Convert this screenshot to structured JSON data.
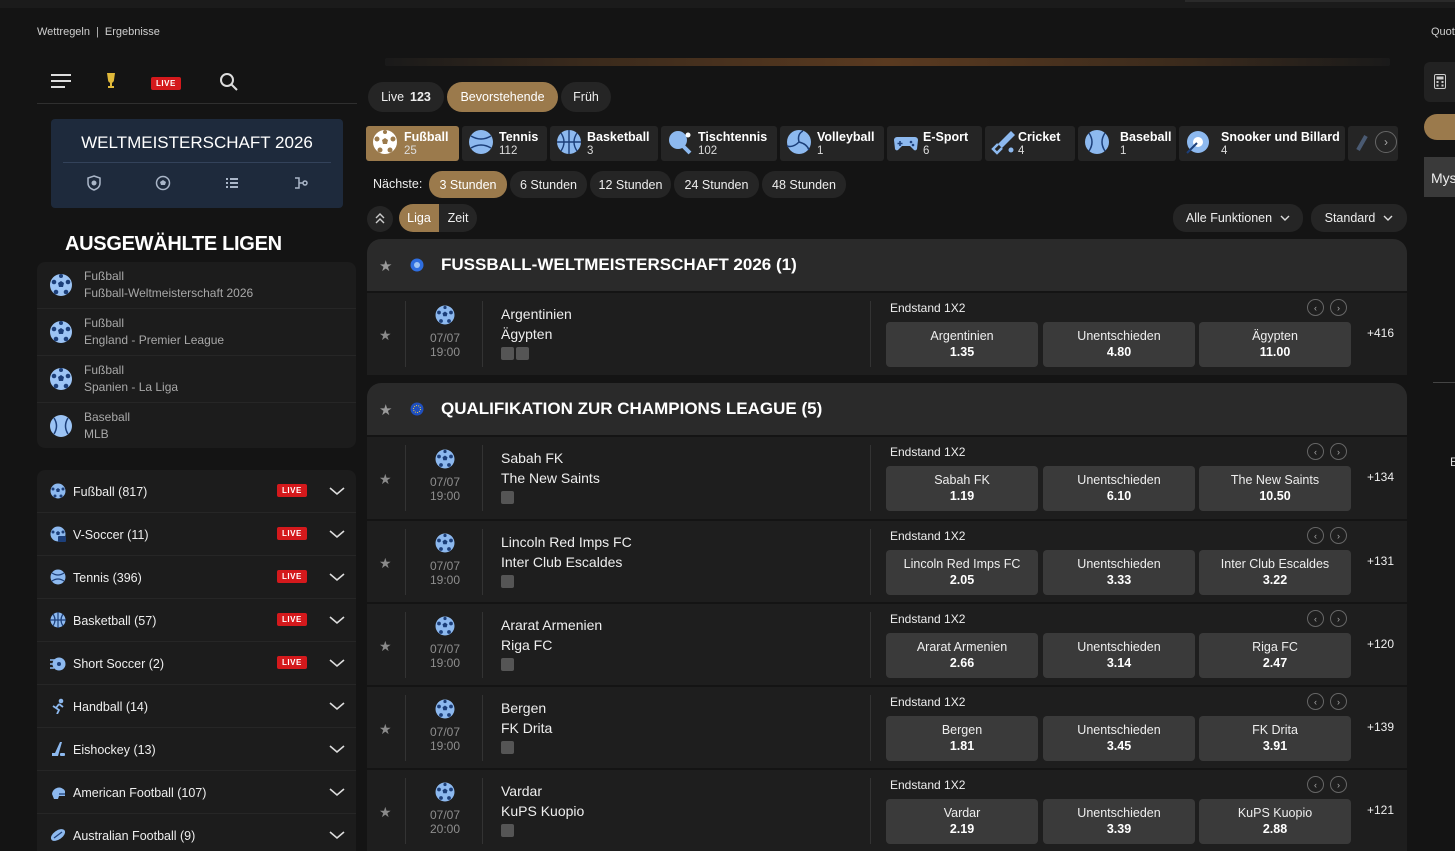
{
  "top": {
    "links": [
      "Wettregeln",
      "Ergebnisse"
    ],
    "separator": "|",
    "right_label": "Quot"
  },
  "nav_icons": [
    "menu-icon",
    "trophy-icon",
    "live-badge",
    "search-icon"
  ],
  "live_label": "LIVE",
  "featured": {
    "title": "WELTMEISTERSCHAFT 2026",
    "icons": [
      "shield-icon",
      "football-icon",
      "list-icon",
      "bracket-icon"
    ]
  },
  "ausgewaehlte": {
    "title": "AUSGEWÄHLTE LIGEN",
    "items": [
      {
        "sport": "Fußball",
        "league": "Fußball-Weltmeisterschaft 2026"
      },
      {
        "sport": "Fußball",
        "league": "England - Premier League"
      },
      {
        "sport": "Fußball",
        "league": "Spanien - La Liga"
      },
      {
        "sport": "Baseball",
        "league": "MLB"
      }
    ]
  },
  "sports": [
    {
      "label": "Fußball (817)",
      "live": true
    },
    {
      "label": "V-Soccer (11)",
      "live": true
    },
    {
      "label": "Tennis (396)",
      "live": true
    },
    {
      "label": "Basketball (57)",
      "live": true
    },
    {
      "label": "Short Soccer (2)",
      "live": true
    },
    {
      "label": "Handball (14)",
      "live": false
    },
    {
      "label": "Eishockey (13)",
      "live": false
    },
    {
      "label": "American Football (107)",
      "live": false
    },
    {
      "label": "Australian Football (9)",
      "live": false
    }
  ],
  "tabs": {
    "live": "Live",
    "live_count": "123",
    "upcoming": "Bevorstehende",
    "early": "Früh"
  },
  "categories": [
    {
      "name": "Fußball",
      "count": "25"
    },
    {
      "name": "Tennis",
      "count": "112"
    },
    {
      "name": "Basketball",
      "count": "3"
    },
    {
      "name": "Tischtennis",
      "count": "102"
    },
    {
      "name": "Volleyball",
      "count": "1"
    },
    {
      "name": "E-Sport",
      "count": "6"
    },
    {
      "name": "Cricket",
      "count": "4"
    },
    {
      "name": "Baseball",
      "count": "1"
    },
    {
      "name": "Snooker und Billard",
      "count": "4"
    }
  ],
  "naechste": {
    "label": "Nächste:",
    "options": [
      "3 Stunden",
      "6 Stunden",
      "12 Stunden",
      "24 Stunden",
      "48 Stunden"
    ]
  },
  "sort": {
    "liga": "Liga",
    "zeit": "Zeit"
  },
  "filters": {
    "functions": "Alle Funktionen",
    "standard": "Standard"
  },
  "sections": [
    {
      "title": "FUSSBALL-WELTMEISTERSCHAFT 2026 (1)"
    },
    {
      "title": "QUALIFIKATION ZUR CHAMPIONS LEAGUE (5)"
    }
  ],
  "market_label": "Endstand 1X2",
  "matches": [
    {
      "date": "07/07",
      "time": "19:00",
      "home": "Argentinien",
      "away": "Ägypten",
      "odds": [
        {
          "label": "Argentinien",
          "value": "1.35"
        },
        {
          "label": "Unentschieden",
          "value": "4.80"
        },
        {
          "label": "Ägypten",
          "value": "11.00"
        }
      ],
      "more": "+416"
    },
    {
      "date": "07/07",
      "time": "19:00",
      "home": "Sabah FK",
      "away": "The New Saints",
      "odds": [
        {
          "label": "Sabah FK",
          "value": "1.19"
        },
        {
          "label": "Unentschieden",
          "value": "6.10"
        },
        {
          "label": "The New Saints",
          "value": "10.50"
        }
      ],
      "more": "+134"
    },
    {
      "date": "07/07",
      "time": "19:00",
      "home": "Lincoln Red Imps FC",
      "away": "Inter Club Escaldes",
      "odds": [
        {
          "label": "Lincoln Red Imps FC",
          "value": "2.05"
        },
        {
          "label": "Unentschieden",
          "value": "3.33"
        },
        {
          "label": "Inter Club Escaldes",
          "value": "3.22"
        }
      ],
      "more": "+131"
    },
    {
      "date": "07/07",
      "time": "19:00",
      "home": "Ararat Armenien",
      "away": "Riga FC",
      "odds": [
        {
          "label": "Ararat Armenien",
          "value": "2.66"
        },
        {
          "label": "Unentschieden",
          "value": "3.14"
        },
        {
          "label": "Riga FC",
          "value": "2.47"
        }
      ],
      "more": "+120"
    },
    {
      "date": "07/07",
      "time": "19:00",
      "home": "Bergen",
      "away": "FK Drita",
      "odds": [
        {
          "label": "Bergen",
          "value": "1.81"
        },
        {
          "label": "Unentschieden",
          "value": "3.45"
        },
        {
          "label": "FK Drita",
          "value": "3.91"
        }
      ],
      "more": "+139"
    },
    {
      "date": "07/07",
      "time": "20:00",
      "home": "Vardar",
      "away": "KuPS Kuopio",
      "odds": [
        {
          "label": "Vardar",
          "value": "2.19"
        },
        {
          "label": "Unentschieden",
          "value": "3.39"
        },
        {
          "label": "KuPS Kuopio",
          "value": "2.88"
        }
      ],
      "more": "+121"
    }
  ],
  "right_panel": {
    "text": "Mys",
    "edge_letter": "E"
  },
  "colors": {
    "accent": "#9b7a4c",
    "live": "#d4191c",
    "background": "#141414",
    "panel": "#1e1e1e"
  }
}
